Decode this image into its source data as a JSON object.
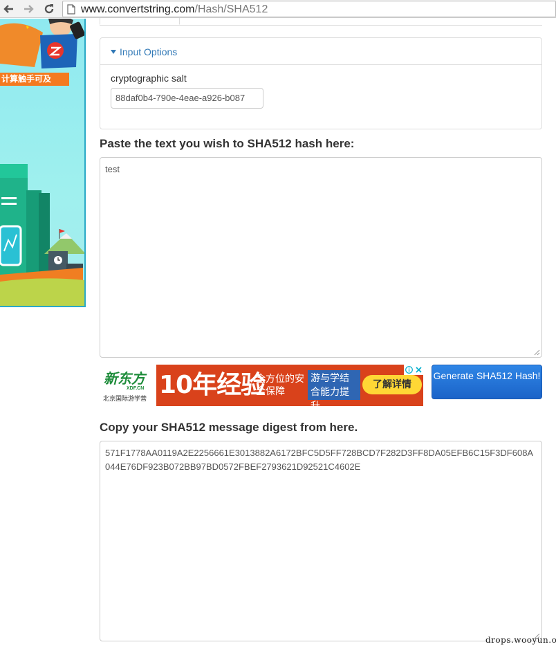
{
  "browser": {
    "url_host": "www.convertstring.com",
    "url_path": "/Hash/SHA512"
  },
  "side_ad": {
    "strip_text": "计算触手可及"
  },
  "options": {
    "header": "Input Options",
    "salt_label": "cryptographic salt",
    "salt_value": "88daf0b4-790e-4eae-a926-b087"
  },
  "input": {
    "label": "Paste the text you wish to SHA512 hash here:",
    "value": "test"
  },
  "banner_ad": {
    "logo": "新东方",
    "logo_domain": "XDF.CN",
    "logo_caption": "北京国际游学营",
    "headline": "10年经验",
    "tagline": "全方位的安全保障",
    "highlight": "游与学结合能力提升",
    "cta": "了解详情"
  },
  "generate_button": {
    "label": "Generate SHA512 Hash!"
  },
  "output": {
    "label": "Copy your SHA512 message digest from here.",
    "value": "571F1778AA0119A2E2256661E3013882A6172BFC5D5FF728BCD7F282D3FF8DA05EFB6C15F3DF608A044E76DF923B072BB97BD0572FBEF2793621D92521C4602E"
  },
  "watermark": "drops.wooyun.org",
  "colors": {
    "link_blue": "#337ab7",
    "button_blue": "#1b63c8",
    "ad_orange": "#f47a20",
    "ad_red": "#d9421b"
  },
  "icons": [
    "back-arrow-icon",
    "forward-arrow-icon",
    "reload-icon",
    "page-icon",
    "caret-down-icon",
    "resize-grip-icon",
    "ad-info-icon",
    "ad-close-icon"
  ]
}
